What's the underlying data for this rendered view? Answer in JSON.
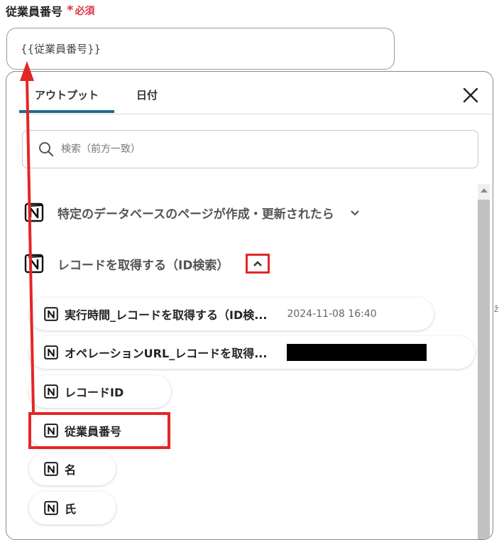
{
  "field": {
    "label": "従業員番号",
    "required_mark": "*",
    "required_text": "必須",
    "value": "{{従業員番号}}"
  },
  "tabs": [
    {
      "label": "アウトプット",
      "active": true
    },
    {
      "label": "日付",
      "active": false
    }
  ],
  "search": {
    "placeholder": "検索（前方一致）"
  },
  "sections": [
    {
      "title": "特定のデータベースのページが作成・更新されたら",
      "expanded": false
    },
    {
      "title": "レコードを取得する（ID検索）",
      "expanded": true
    }
  ],
  "items": [
    {
      "label": "実行時間_レコードを取得する（ID検...",
      "meta": "2024-11-08 16:40"
    },
    {
      "label": "オペレーションURL_レコードを取得..."
    },
    {
      "label": "レコードID"
    },
    {
      "label": "従業員番号"
    },
    {
      "label": "名"
    },
    {
      "label": "氏"
    }
  ],
  "stray_char": "ž",
  "colors": {
    "accent": "#1f6a8a",
    "annotation_red": "#e32626",
    "required_red": "#e0344a"
  },
  "icons": {
    "app": "notion-icon",
    "close": "close-icon",
    "search": "search-icon",
    "chevron_down": "chevron-down-icon",
    "chevron_up": "chevron-up-icon"
  }
}
